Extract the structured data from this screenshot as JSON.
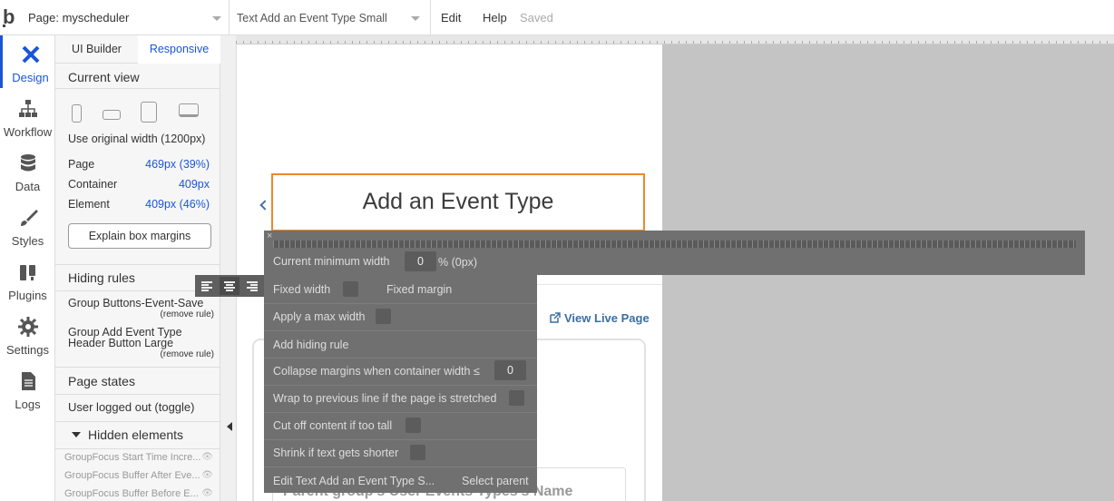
{
  "topbar": {
    "page_selector": "Page: myscheduler",
    "element_selector": "Text Add an Event Type Small",
    "menu_edit": "Edit",
    "menu_help": "Help",
    "save_status": "Saved"
  },
  "nav": {
    "items": [
      {
        "label": "Design",
        "icon": "design-icon"
      },
      {
        "label": "Workflow",
        "icon": "workflow-icon"
      },
      {
        "label": "Data",
        "icon": "database-icon"
      },
      {
        "label": "Styles",
        "icon": "brush-icon"
      },
      {
        "label": "Plugins",
        "icon": "plug-icon"
      },
      {
        "label": "Settings",
        "icon": "gear-icon"
      },
      {
        "label": "Logs",
        "icon": "document-icon"
      }
    ],
    "active": "Design"
  },
  "panel": {
    "tabs": [
      "UI Builder",
      "Responsive"
    ],
    "active_tab": "Responsive",
    "current_view_title": "Current view",
    "use_original_width": "Use original width (1200px)",
    "metrics": [
      {
        "label": "Page",
        "value": "469px (39%)"
      },
      {
        "label": "Container",
        "value": "409px"
      },
      {
        "label": "Element",
        "value": "409px (46%)"
      }
    ],
    "explain_button": "Explain box margins",
    "hiding_rules_title": "Hiding rules",
    "rules": [
      {
        "name": "Group Buttons-Event-Save",
        "action": "(remove rule)"
      },
      {
        "name": "Group Add Event Type Header Button Large",
        "action": "(remove rule)"
      }
    ],
    "page_states_title": "Page states",
    "page_state": "User logged out (toggle)",
    "hidden_elements_title": "Hidden elements",
    "hidden_elements": [
      "GroupFocus Start Time Incre...",
      "GroupFocus Buffer After Eve...",
      "GroupFocus Buffer Before E..."
    ]
  },
  "canvas": {
    "heading": "Add an Event Type",
    "live_link": "View Live Page",
    "input_text": "Parent group's User Events Types's Name"
  },
  "overlay": {
    "close": "×",
    "current_min_width_label": "Current minimum width",
    "current_min_width_value": "0",
    "current_min_width_suffix": "% (0px)",
    "fixed_width": "Fixed width",
    "fixed_margin": "Fixed margin",
    "apply_max_width": "Apply a max width",
    "add_hiding_rule": "Add hiding rule",
    "collapse_margins": "Collapse margins when container width ≤",
    "collapse_value": "0",
    "wrap_previous": "Wrap to previous line if the page is stretched",
    "cut_off": "Cut off content if too tall",
    "shrink": "Shrink if text gets shorter",
    "edit_element": "Edit Text Add an Event Type S...",
    "select_parent": "Select parent"
  }
}
